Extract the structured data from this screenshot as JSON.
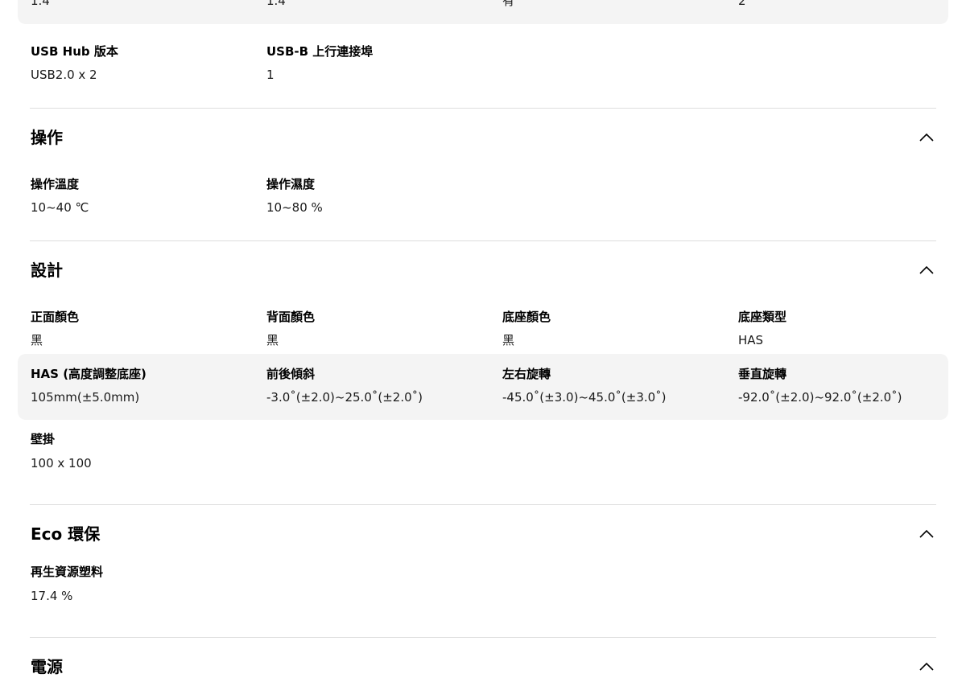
{
  "top_row": {
    "values": [
      "1.4",
      "1.4",
      "有",
      "2"
    ]
  },
  "usb_row": {
    "items": [
      {
        "label": "USB Hub 版本",
        "value": "USB2.0 x 2"
      },
      {
        "label": "USB-B 上行連接埠",
        "value": "1"
      }
    ]
  },
  "operation": {
    "title": "操作",
    "items": [
      {
        "label": "操作溫度",
        "value": "10~40 ℃"
      },
      {
        "label": "操作濕度",
        "value": "10~80 %"
      }
    ]
  },
  "design": {
    "title": "設計",
    "row1": [
      {
        "label": "正面顏色",
        "value": "黑"
      },
      {
        "label": "背面顏色",
        "value": "黑"
      },
      {
        "label": "底座顏色",
        "value": "黑"
      },
      {
        "label": "底座類型",
        "value": "HAS"
      }
    ],
    "row2": [
      {
        "label": "HAS (高度調整底座)",
        "value": "105mm(±5.0mm)"
      },
      {
        "label": "前後傾斜",
        "value": "-3.0˚(±2.0)~25.0˚(±2.0˚)"
      },
      {
        "label": "左右旋轉",
        "value": "-45.0˚(±3.0)~45.0˚(±3.0˚)"
      },
      {
        "label": "垂直旋轉",
        "value": "-92.0˚(±2.0)~92.0˚(±2.0˚)"
      }
    ],
    "row3": [
      {
        "label": "壁掛",
        "value": "100 x 100"
      }
    ]
  },
  "eco": {
    "title": "Eco 環保",
    "items": [
      {
        "label": "再生資源塑料",
        "value": "17.4 %"
      }
    ]
  },
  "power": {
    "title": "電源"
  },
  "icons": {
    "collapse": "chevron-up-icon"
  }
}
